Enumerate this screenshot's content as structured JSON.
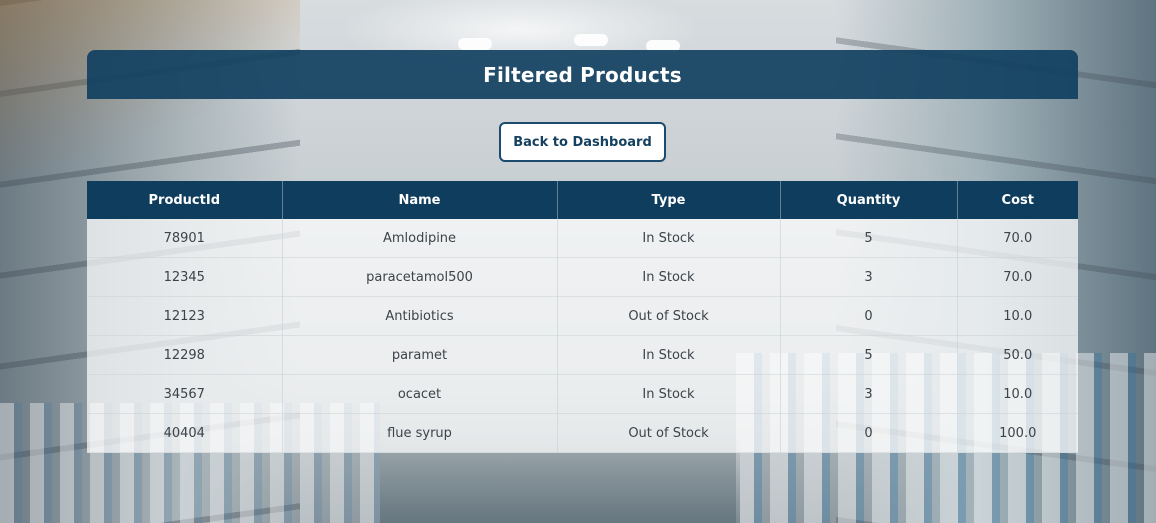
{
  "page": {
    "title": "Filtered Products"
  },
  "actions": {
    "back_label": "Back to Dashboard"
  },
  "table": {
    "columns": [
      "ProductId",
      "Name",
      "Type",
      "Quantity",
      "Cost"
    ],
    "rows": [
      [
        "78901",
        "Amlodipine",
        "In Stock",
        "5",
        "70.0"
      ],
      [
        "12345",
        "paracetamol500",
        "In Stock",
        "3",
        "70.0"
      ],
      [
        "12123",
        "Antibiotics",
        "Out of Stock",
        "0",
        "10.0"
      ],
      [
        "12298",
        "paramet",
        "In Stock",
        "5",
        "50.0"
      ],
      [
        "34567",
        "ocacet",
        "In Stock",
        "3",
        "10.0"
      ],
      [
        "40404",
        "flue syrup",
        "Out of Stock",
        "0",
        "100.0"
      ]
    ]
  },
  "colors": {
    "header_bg": "#114061",
    "table_header_bg": "#0f3d5e",
    "button_border": "#1c4b6e",
    "row_bg": "#ffffff"
  }
}
